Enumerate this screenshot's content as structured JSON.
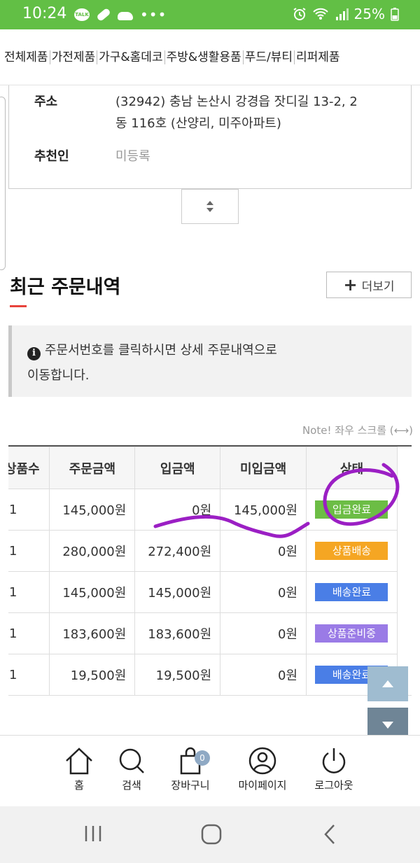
{
  "statusbar": {
    "time": "10:24",
    "talk_label": "TALK",
    "battery": "25%"
  },
  "categories": [
    "전체제품",
    "가전제품",
    "가구&홈데코",
    "주방&생활용품",
    "푸드/뷰티",
    "리퍼제품"
  ],
  "info": {
    "address_label": "주소",
    "address_line1": "(32942) 충남 논산시 강경읍 잣디길 13-2, 2",
    "address_line2": "동 116호 (산양리, 미주아파트)",
    "recommender_label": "추천인",
    "recommender_value": "미등록"
  },
  "orders": {
    "title": "최근 주문내역",
    "more_label": "더보기",
    "notice_line1": "주문서번호를 클릭하시면 상세 주문내역으로",
    "notice_line2": "이동합니다.",
    "scroll_note": "Note! 좌우 스크롤 (⟷)",
    "columns": [
      "상품수",
      "주문금액",
      "입금액",
      "미입금액",
      "상태"
    ],
    "rows": [
      {
        "count": "1",
        "order": "145,000원",
        "paid": "0원",
        "unpaid": "145,000원",
        "status": "입금완료",
        "color": "#6cbd45"
      },
      {
        "count": "1",
        "order": "280,000원",
        "paid": "272,400원",
        "unpaid": "0원",
        "status": "상품배송",
        "color": "#f5a623"
      },
      {
        "count": "1",
        "order": "145,000원",
        "paid": "145,000원",
        "unpaid": "0원",
        "status": "배송완료",
        "color": "#4a7ee6"
      },
      {
        "count": "1",
        "order": "183,600원",
        "paid": "183,600원",
        "unpaid": "0원",
        "status": "상품준비중",
        "color": "#9a7be6"
      },
      {
        "count": "1",
        "order": "19,500원",
        "paid": "19,500원",
        "unpaid": "0원",
        "status": "배송완료",
        "color": "#4a7ee6"
      }
    ]
  },
  "bottomnav": {
    "home": "홈",
    "search": "검색",
    "cart": "장바구니",
    "cart_count": "0",
    "mypage": "마이페이지",
    "logout": "로그아웃"
  },
  "colors": {
    "statusbar": "#62bf45",
    "accent": "#e8433b",
    "annotation": "#9b1fc4"
  }
}
